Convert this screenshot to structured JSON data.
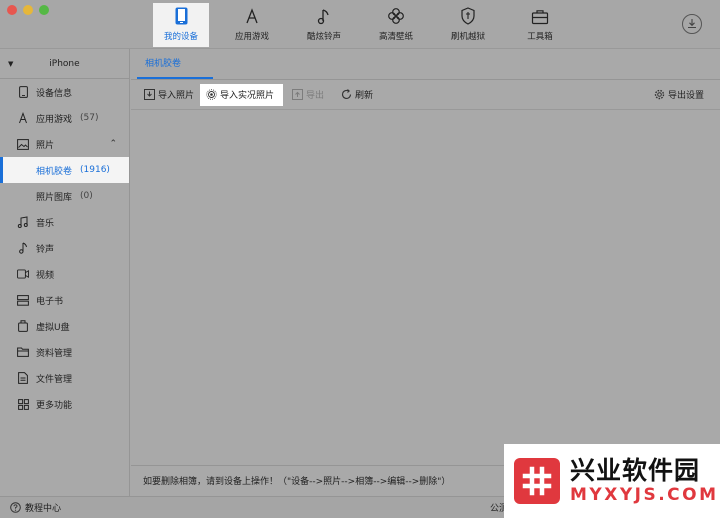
{
  "topnav": {
    "items": [
      {
        "label": "我的设备",
        "icon": "phone-icon",
        "active": true
      },
      {
        "label": "应用游戏",
        "icon": "app-store-icon"
      },
      {
        "label": "酷炫铃声",
        "icon": "music-note-icon"
      },
      {
        "label": "高清壁纸",
        "icon": "clover-icon"
      },
      {
        "label": "刷机越狱",
        "icon": "shield-icon"
      },
      {
        "label": "工具箱",
        "icon": "toolbox-icon"
      }
    ],
    "download_icon": "download-icon"
  },
  "sidebar": {
    "device_name": "iPhone",
    "items": [
      {
        "label": "设备信息",
        "icon": "phone-info-icon"
      },
      {
        "label": "应用游戏",
        "count": "(57)",
        "icon": "app-icon"
      },
      {
        "label": "照片",
        "icon": "photo-icon"
      },
      {
        "label": "相机胶卷",
        "count": "(1916)",
        "active": true
      },
      {
        "label": "照片图库",
        "count": "(0)"
      },
      {
        "label": "音乐",
        "icon": "music-icon"
      },
      {
        "label": "铃声",
        "icon": "ringtone-icon"
      },
      {
        "label": "视频",
        "icon": "video-icon"
      },
      {
        "label": "电子书",
        "icon": "book-icon"
      },
      {
        "label": "虚拟U盘",
        "icon": "usb-icon"
      },
      {
        "label": "资料管理",
        "icon": "folder-icon"
      },
      {
        "label": "文件管理",
        "icon": "file-icon"
      },
      {
        "label": "更多功能",
        "icon": "grid-icon"
      }
    ]
  },
  "main": {
    "tab": "相机胶卷",
    "toolbar": {
      "import_photo": "导入照片",
      "import_live": "导入实况照片",
      "export": "导出",
      "refresh": "刷新",
      "export_settings": "导出设置"
    },
    "hint": "如要删除相簿，请到设备上操作！（\"设备-->照片-->相簿-->编辑-->删除\"）"
  },
  "statusbar": {
    "tutorial": "教程中心",
    "right_text": "公测"
  },
  "watermark": {
    "cn": "兴业软件园",
    "en": "MYXYJS.COM"
  },
  "colors": {
    "accent": "#1a6fd8",
    "watermark_red": "#e0383e"
  }
}
